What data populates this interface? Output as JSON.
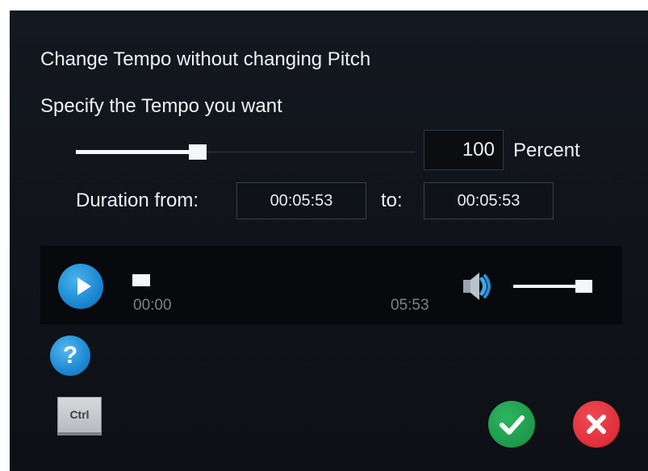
{
  "dialog": {
    "title": "Change Tempo without changing Pitch",
    "subtitle": "Specify the Tempo you want"
  },
  "tempo": {
    "value": "100",
    "unit_label": "Percent",
    "slider_fraction": 0.36
  },
  "duration": {
    "from_label": "Duration from:",
    "from_value": "00:05:53",
    "to_label": "to:",
    "to_value": "00:05:53"
  },
  "player": {
    "current_time": "00:00",
    "total_time": "05:53",
    "progress_fraction": 0,
    "volume_fraction": 0.95
  },
  "buttons": {
    "help_glyph": "?",
    "ctrl_key_label": "Ctrl"
  },
  "icons": {
    "play": "play-icon",
    "speaker": "speaker-icon",
    "help": "help-icon",
    "confirm": "checkmark-icon",
    "cancel": "close-icon"
  },
  "colors": {
    "background": "#101319",
    "accent_blue": "#1b88d2",
    "ok_green": "#1d9a4a",
    "cancel_red": "#df2f3b"
  }
}
